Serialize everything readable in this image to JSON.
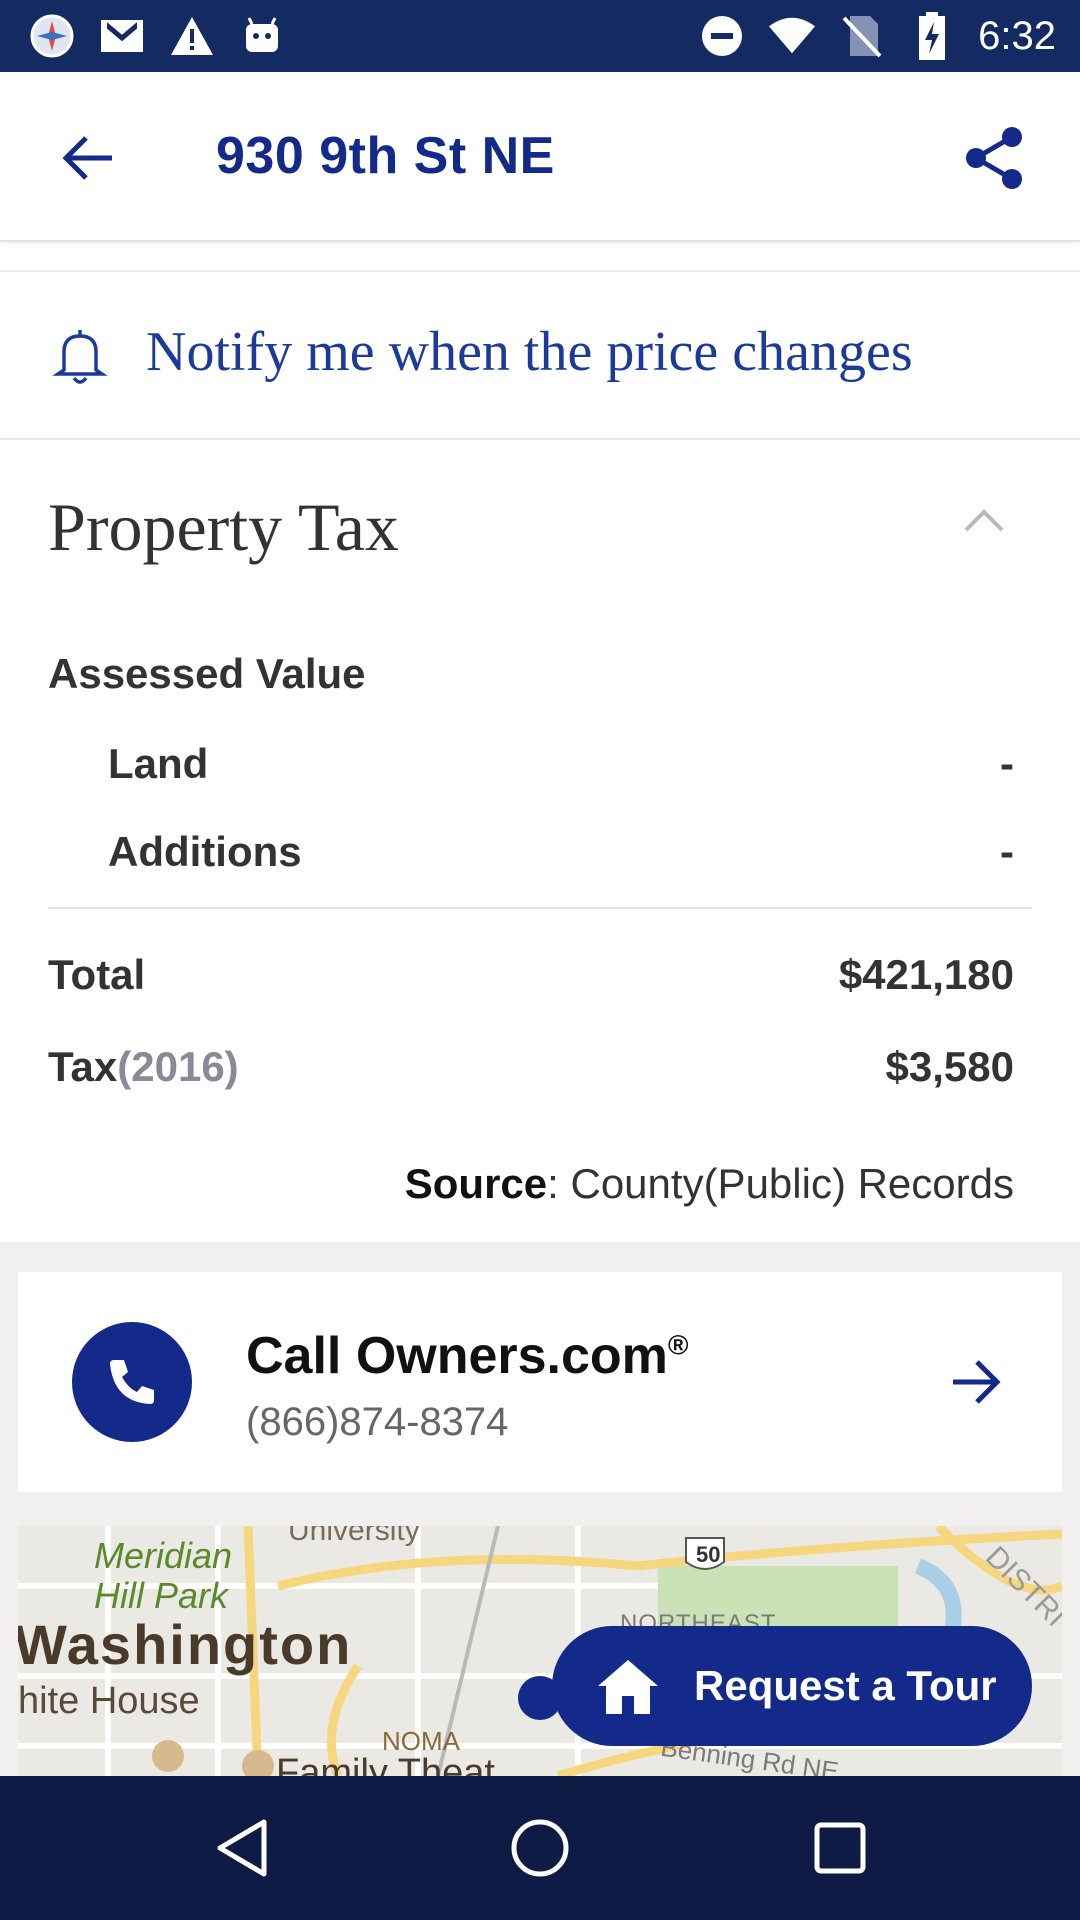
{
  "status_bar": {
    "time": "6:32",
    "left_icons": [
      "compass-icon",
      "gmail-icon",
      "warning-icon",
      "android-icon"
    ],
    "right_icons": [
      "do-not-disturb-icon",
      "wifi-icon",
      "no-sim-icon",
      "battery-charging-icon"
    ]
  },
  "app_bar": {
    "title": "930 9th St NE",
    "back_icon": "arrow-left-icon",
    "share_icon": "share-icon"
  },
  "notify": {
    "label": "Notify me when the price changes",
    "icon": "bell-icon"
  },
  "property_tax": {
    "title": "Property Tax",
    "assessed_value_label": "Assessed Value",
    "land_label": "Land",
    "land_value": "-",
    "additions_label": "Additions",
    "additions_value": "-",
    "total_label": "Total",
    "total_value": "$421,180",
    "tax_label": "Tax",
    "tax_year": "(2016)",
    "tax_value": "$3,580",
    "source_label": "Source",
    "source_value": ": County(Public) Records"
  },
  "call_card": {
    "title": "Call Owners.com",
    "trademark": "®",
    "phone": "(866)874-8374"
  },
  "map": {
    "labels": {
      "park": "Meridian\nHill Park",
      "city": "Washington",
      "white_house": "hite House",
      "noma": "NOMA",
      "northeast": "NORTHEAST",
      "route": "50",
      "benning": "Benning Rd NE",
      "district": "DISTRI",
      "university": "University",
      "fragment": "Family Theat"
    }
  },
  "tour_button": {
    "label": "Request a Tour"
  },
  "colors": {
    "brand_navy": "#142a8a",
    "status_bar": "#142a63",
    "nav_bar": "#0e1b45"
  }
}
